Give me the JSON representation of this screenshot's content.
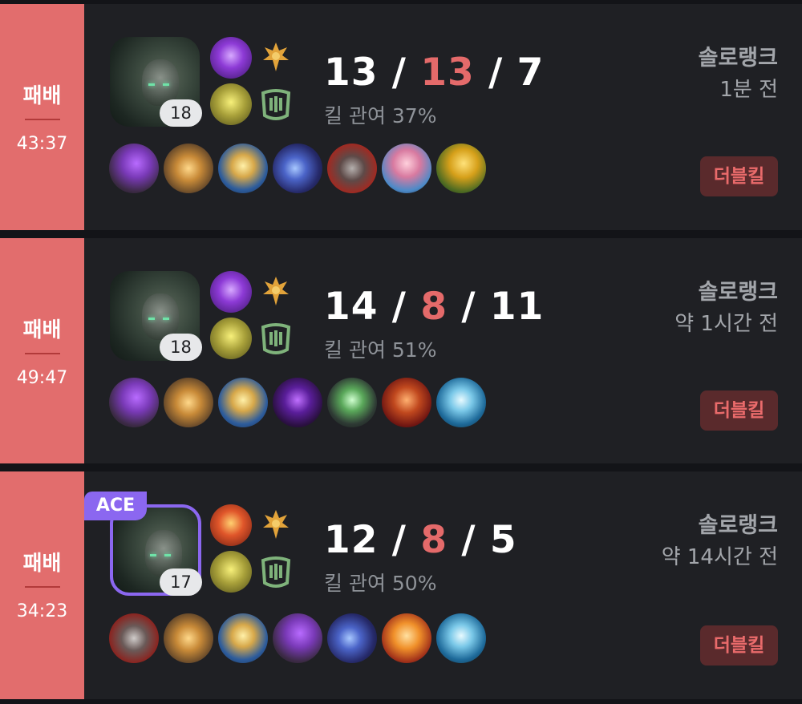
{
  "colors": {
    "loss_bg": "#e26d6d",
    "deaths": "#e46a6a",
    "ace_badge": "#8b67f0",
    "multikill_bg": "#5a2a2c",
    "multikill_text": "#ea6b6b",
    "card_bg": "#1f2024"
  },
  "matches": [
    {
      "result": "패배",
      "duration": "43:37",
      "level": "18",
      "badge": null,
      "kills": "13",
      "deaths": "13",
      "assists": "7",
      "kill_participation": "킬 관여 37%",
      "queue": "솔로랭크",
      "time_ago": "1분 전",
      "multikill": "더블킬",
      "spells": [
        "purple-flash-spell-icon",
        "green-ghost-spell-icon"
      ],
      "runes": [
        "gold-conqueror-rune-icon",
        "green-resolve-rune-icon"
      ],
      "items": [
        "purple-armor-item-icon",
        "golden-core-item-icon",
        "hourglass-item-icon",
        "blue-blade-item-icon",
        "red-boots-item-icon",
        "pink-figure-item-icon",
        "gold-ward-item-icon"
      ]
    },
    {
      "result": "패배",
      "duration": "49:47",
      "level": "18",
      "badge": null,
      "kills": "14",
      "deaths": "8",
      "assists": "11",
      "kill_participation": "킬 관여 51%",
      "queue": "솔로랭크",
      "time_ago": "약 1시간 전",
      "multikill": "더블킬",
      "spells": [
        "purple-flash-spell-icon",
        "green-ghost-spell-icon"
      ],
      "runes": [
        "gold-conqueror-rune-icon",
        "green-resolve-rune-icon"
      ],
      "items": [
        "purple-armor-item-icon",
        "golden-core-item-icon",
        "hourglass-item-icon",
        "dark-mask-item-icon",
        "green-armor-item-icon",
        "red-gauntlet-item-icon",
        "blue-orb-item-icon"
      ]
    },
    {
      "result": "패배",
      "duration": "34:23",
      "level": "17",
      "badge": "ACE",
      "kills": "12",
      "deaths": "8",
      "assists": "5",
      "kill_participation": "킬 관여 50%",
      "queue": "솔로랭크",
      "time_ago": "약 14시간 전",
      "multikill": "더블킬",
      "spells": [
        "red-ignite-spell-icon",
        "green-ghost-spell-icon"
      ],
      "runes": [
        "gold-conqueror-rune-icon",
        "green-resolve-rune-icon"
      ],
      "items": [
        "red-boots-item-icon",
        "golden-core-item-icon",
        "hourglass-item-icon",
        "purple-armor-item-icon",
        "blue-blade-item-icon",
        "orange-orb-item-icon",
        "blue-orb-item-icon"
      ]
    }
  ]
}
